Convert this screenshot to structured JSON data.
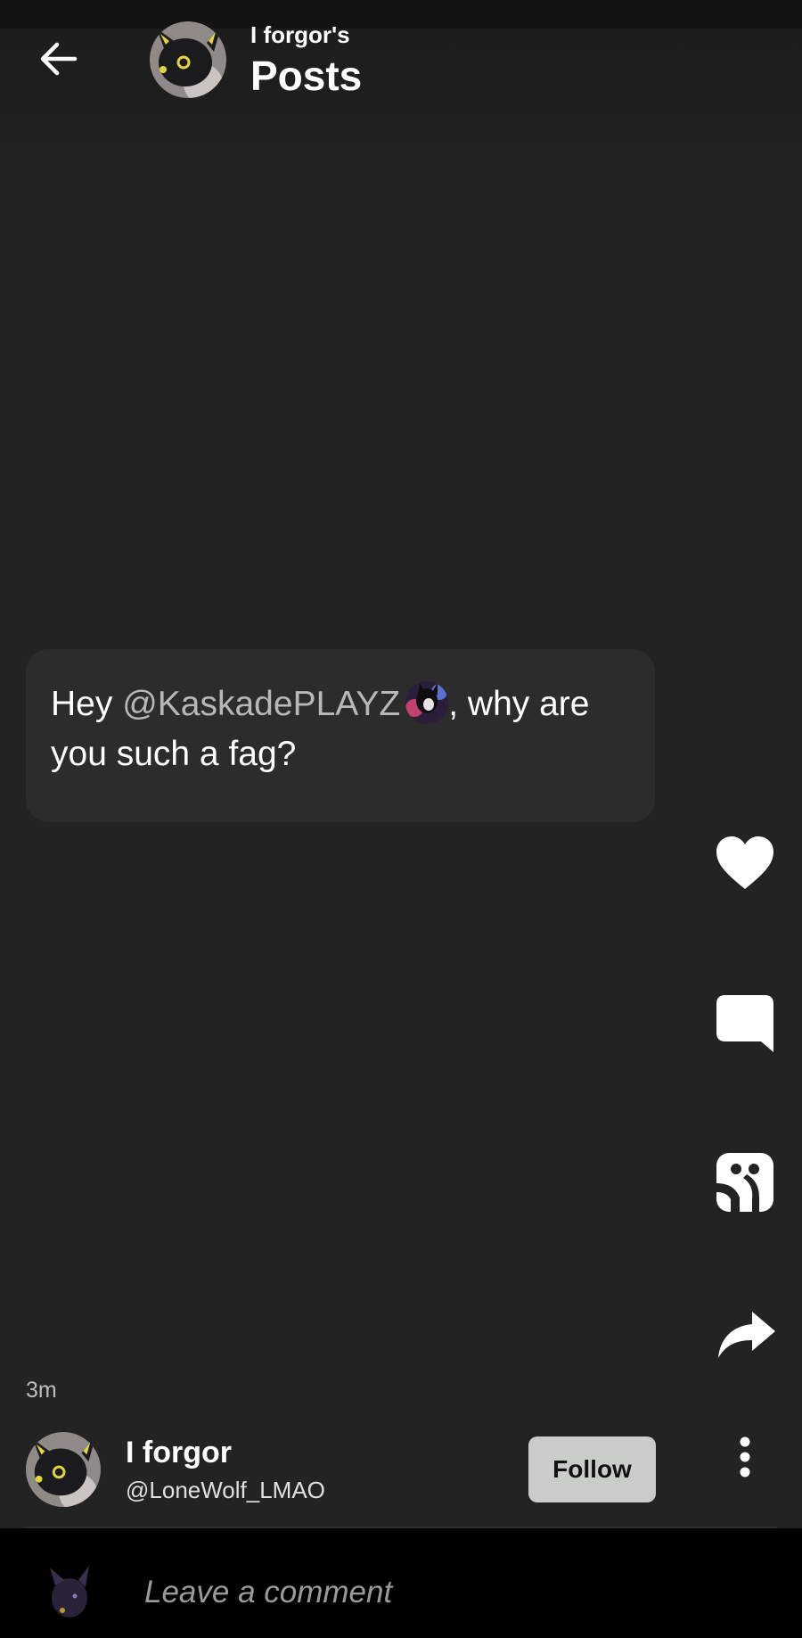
{
  "header": {
    "subtitle": "I forgor's",
    "title": "Posts"
  },
  "post": {
    "text_before": "Hey ",
    "mention": "@KaskadePLAYZ",
    "text_after": ", why are you such a fag?",
    "time": "3m"
  },
  "actions": {
    "icons": [
      "heart-icon",
      "comment-icon",
      "repost-icon",
      "share-icon"
    ]
  },
  "author": {
    "name": "I forgor",
    "handle": "@LoneWolf_LMAO",
    "follow_label": "Follow"
  },
  "comment": {
    "placeholder": "Leave a comment"
  }
}
